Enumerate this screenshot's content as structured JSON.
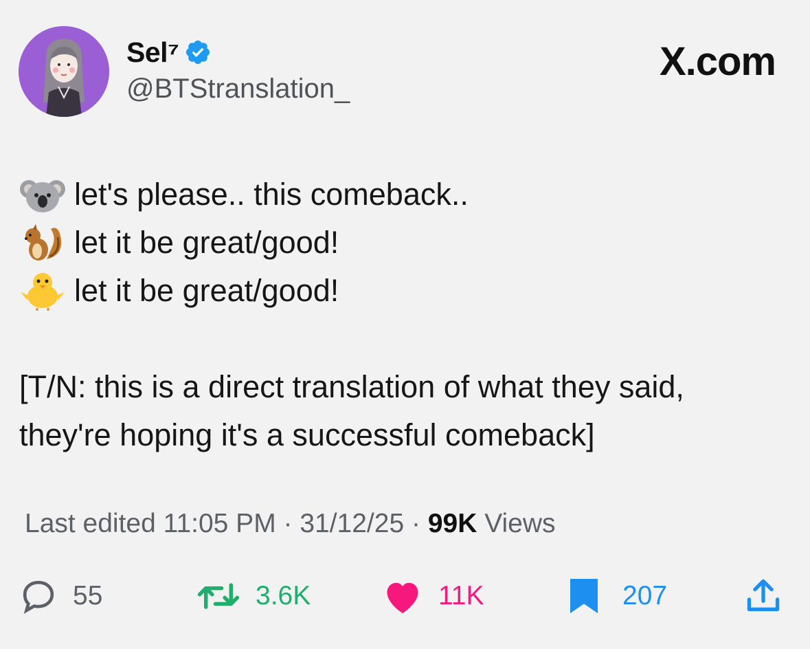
{
  "author": {
    "display_name": "Sel⁷",
    "handle": "@BTStranslation_",
    "verified": true,
    "avatar_color": "#9a5fd4"
  },
  "brand": "X.com",
  "tweet": {
    "lines": [
      {
        "emoji": "koala",
        "text": "let's please.. this comeback.."
      },
      {
        "emoji": "chipmunk",
        "text": "let it be great/good!"
      },
      {
        "emoji": "baby-chick",
        "text": "let it be great/good!"
      }
    ],
    "note_line1": "[T/N: this is a direct translation of what they said,",
    "note_line2": "they're hoping it's a successful comeback]"
  },
  "meta": {
    "prefix": "Last edited 11:05 PM · 31/12/25",
    "separator": " · ",
    "views_count": "99K",
    "views_label": " Views"
  },
  "actions": {
    "replies": "55",
    "reposts": "3.6K",
    "likes": "11K",
    "bookmarks": "207",
    "colors": {
      "reply": "#5c6067",
      "repost": "#1fae6c",
      "like": "#f7187e",
      "bookmark": "#1d8ff0",
      "share": "#1d8ff0"
    }
  }
}
